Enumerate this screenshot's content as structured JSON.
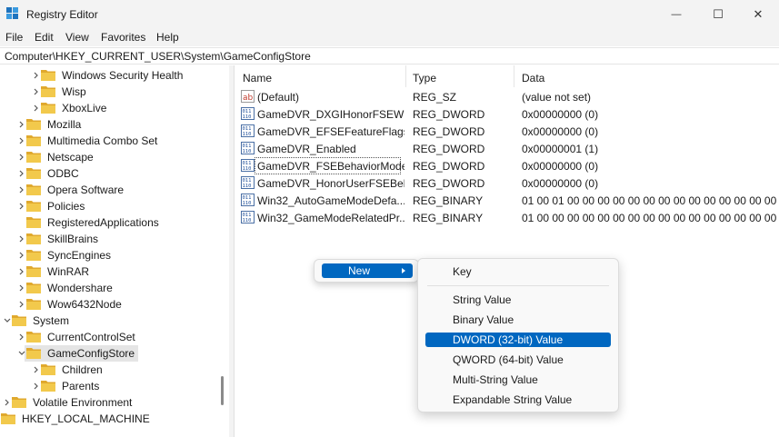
{
  "window": {
    "title": "Registry Editor",
    "minimize_glyph": "—",
    "maximize_glyph": "☐",
    "close_glyph": "✕"
  },
  "menu": [
    {
      "label": "File"
    },
    {
      "label": "Edit"
    },
    {
      "label": "View"
    },
    {
      "label": "Favorites"
    },
    {
      "label": "Help"
    }
  ],
  "address": "Computer\\HKEY_CURRENT_USER\\System\\GameConfigStore",
  "tree": [
    {
      "label": "Windows Security Health",
      "depth": 3,
      "expander": "collapsed"
    },
    {
      "label": "Wisp",
      "depth": 3,
      "expander": "collapsed"
    },
    {
      "label": "XboxLive",
      "depth": 3,
      "expander": "collapsed"
    },
    {
      "label": "Mozilla",
      "depth": 2,
      "expander": "collapsed"
    },
    {
      "label": "Multimedia Combo Set",
      "depth": 2,
      "expander": "collapsed"
    },
    {
      "label": "Netscape",
      "depth": 2,
      "expander": "collapsed"
    },
    {
      "label": "ODBC",
      "depth": 2,
      "expander": "collapsed"
    },
    {
      "label": "Opera Software",
      "depth": 2,
      "expander": "collapsed"
    },
    {
      "label": "Policies",
      "depth": 2,
      "expander": "collapsed"
    },
    {
      "label": "RegisteredApplications",
      "depth": 2,
      "expander": "none"
    },
    {
      "label": "SkillBrains",
      "depth": 2,
      "expander": "collapsed"
    },
    {
      "label": "SyncEngines",
      "depth": 2,
      "expander": "collapsed"
    },
    {
      "label": "WinRAR",
      "depth": 2,
      "expander": "collapsed"
    },
    {
      "label": "Wondershare",
      "depth": 2,
      "expander": "collapsed"
    },
    {
      "label": "Wow6432Node",
      "depth": 2,
      "expander": "collapsed"
    },
    {
      "label": "System",
      "depth": 1,
      "expander": "expanded"
    },
    {
      "label": "CurrentControlSet",
      "depth": 2,
      "expander": "collapsed"
    },
    {
      "label": "GameConfigStore",
      "depth": 2,
      "expander": "expanded",
      "selected": true
    },
    {
      "label": "Children",
      "depth": 3,
      "expander": "collapsed"
    },
    {
      "label": "Parents",
      "depth": 3,
      "expander": "collapsed"
    },
    {
      "label": "Volatile Environment",
      "depth": 1,
      "expander": "collapsed"
    },
    {
      "label": "HKEY_LOCAL_MACHINE",
      "depth": 0,
      "expander": "collapsed"
    }
  ],
  "columns": {
    "name": "Name",
    "type": "Type",
    "data": "Data"
  },
  "values": [
    {
      "name": "(Default)",
      "type": "REG_SZ",
      "data": "(value not set)",
      "icon": "string-value-icon"
    },
    {
      "name": "GameDVR_DXGIHonorFSEWi...",
      "type": "REG_DWORD",
      "data": "0x00000000 (0)",
      "icon": "binary-value-icon"
    },
    {
      "name": "GameDVR_EFSEFeatureFlags",
      "type": "REG_DWORD",
      "data": "0x00000000 (0)",
      "icon": "binary-value-icon"
    },
    {
      "name": "GameDVR_Enabled",
      "type": "REG_DWORD",
      "data": "0x00000001 (1)",
      "icon": "binary-value-icon"
    },
    {
      "name": "GameDVR_FSEBehaviorMode",
      "type": "REG_DWORD",
      "data": "0x00000000 (0)",
      "icon": "binary-value-icon",
      "focused": true
    },
    {
      "name": "GameDVR_HonorUserFSEBeh...",
      "type": "REG_DWORD",
      "data": "0x00000000 (0)",
      "icon": "binary-value-icon"
    },
    {
      "name": "Win32_AutoGameModeDefa...",
      "type": "REG_BINARY",
      "data": "01 00 01 00 00 00 00 00 00 00 00 00 00 00 00 00 00 00 00 00 ...",
      "icon": "binary-value-icon"
    },
    {
      "name": "Win32_GameModeRelatedPr...",
      "type": "REG_BINARY",
      "data": "01 00 00 00 00 00 00 00 00 00 00 00 00 00 00 00 00 00 00 00 ...",
      "icon": "binary-value-icon"
    }
  ],
  "context_menu": {
    "new_label": "New"
  },
  "submenu": [
    {
      "label": "Key"
    },
    {
      "separator": true
    },
    {
      "label": "String Value"
    },
    {
      "label": "Binary Value"
    },
    {
      "label": "DWORD (32-bit) Value",
      "highlighted": true
    },
    {
      "label": "QWORD (64-bit) Value"
    },
    {
      "label": "Multi-String Value"
    },
    {
      "label": "Expandable String Value"
    }
  ],
  "colors": {
    "accent": "#0067c0",
    "folder": "#f2c94c",
    "selection": "#e5e5e5"
  }
}
